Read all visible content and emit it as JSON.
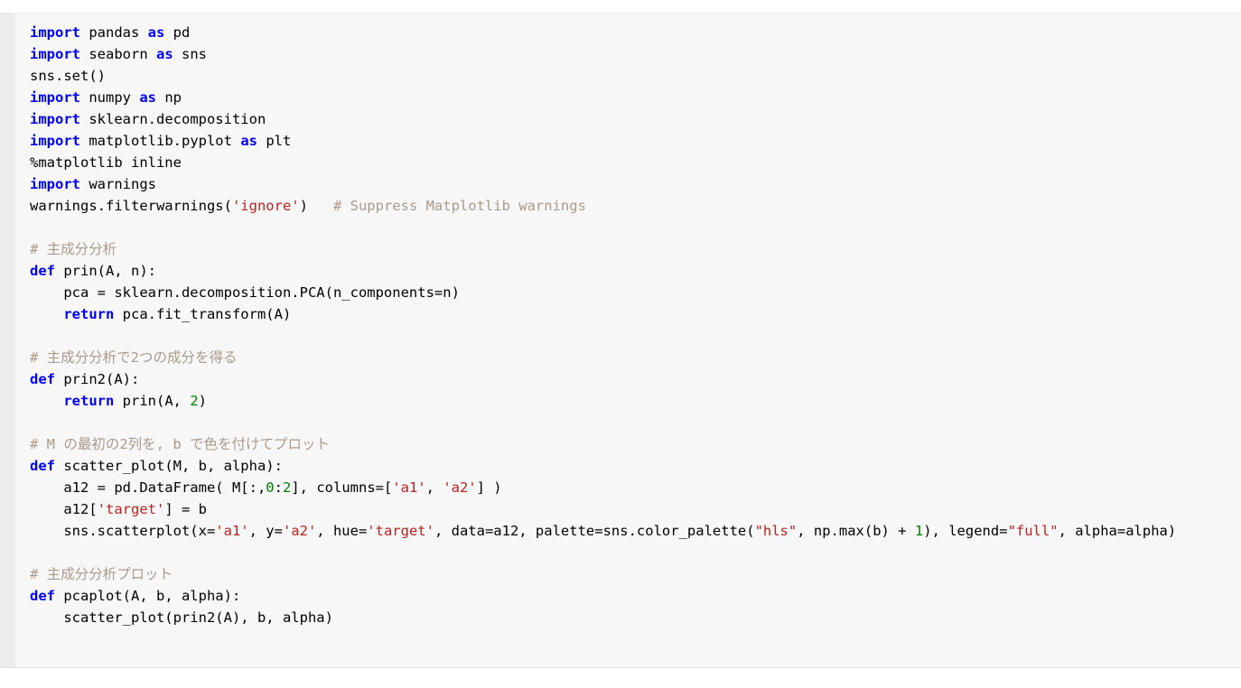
{
  "app": {
    "kind": "jupyter-notebook-code-cell",
    "background_color": "#ffffff",
    "cell_background_color": "#f7f7f7",
    "gutter_color": "#ececec"
  },
  "theme": {
    "keyword_color": "#0000ff",
    "string_color": "#ba2121",
    "comment_color": "#ab9a8a",
    "number_color": "#008000",
    "text_color": "#000000"
  },
  "cell": {
    "language": "python",
    "prompt": "",
    "lines": [
      {
        "tokens": [
          {
            "t": "import",
            "c": "k"
          },
          {
            "t": " pandas ",
            "c": "o"
          },
          {
            "t": "as",
            "c": "k"
          },
          {
            "t": " pd",
            "c": "o"
          }
        ]
      },
      {
        "tokens": [
          {
            "t": "import",
            "c": "k"
          },
          {
            "t": " seaborn ",
            "c": "o"
          },
          {
            "t": "as",
            "c": "k"
          },
          {
            "t": " sns",
            "c": "o"
          }
        ]
      },
      {
        "tokens": [
          {
            "t": "sns.set()",
            "c": "o"
          }
        ]
      },
      {
        "tokens": [
          {
            "t": "import",
            "c": "k"
          },
          {
            "t": " numpy ",
            "c": "o"
          },
          {
            "t": "as",
            "c": "k"
          },
          {
            "t": " np",
            "c": "o"
          }
        ]
      },
      {
        "tokens": [
          {
            "t": "import",
            "c": "k"
          },
          {
            "t": " sklearn.decomposition",
            "c": "o"
          }
        ]
      },
      {
        "tokens": [
          {
            "t": "import",
            "c": "k"
          },
          {
            "t": " matplotlib.pyplot ",
            "c": "o"
          },
          {
            "t": "as",
            "c": "k"
          },
          {
            "t": " plt",
            "c": "o"
          }
        ]
      },
      {
        "tokens": [
          {
            "t": "%matplotlib inline",
            "c": "o"
          }
        ]
      },
      {
        "tokens": [
          {
            "t": "import",
            "c": "k"
          },
          {
            "t": " warnings",
            "c": "o"
          }
        ]
      },
      {
        "tokens": [
          {
            "t": "warnings.filterwarnings(",
            "c": "o"
          },
          {
            "t": "'ignore'",
            "c": "s"
          },
          {
            "t": ")   ",
            "c": "o"
          },
          {
            "t": "# Suppress Matplotlib warnings",
            "c": "c"
          }
        ]
      },
      {
        "tokens": []
      },
      {
        "tokens": [
          {
            "t": "# 主成分分析",
            "c": "c"
          }
        ]
      },
      {
        "tokens": [
          {
            "t": "def",
            "c": "k"
          },
          {
            "t": " prin(A, n):",
            "c": "o"
          }
        ]
      },
      {
        "tokens": [
          {
            "t": "    pca = sklearn.decomposition.PCA(n_components=n)",
            "c": "o"
          }
        ]
      },
      {
        "tokens": [
          {
            "t": "    ",
            "c": "o"
          },
          {
            "t": "return",
            "c": "k"
          },
          {
            "t": " pca.fit_transform(A)",
            "c": "o"
          }
        ]
      },
      {
        "tokens": []
      },
      {
        "tokens": [
          {
            "t": "# 主成分分析で2つの成分を得る",
            "c": "c"
          }
        ]
      },
      {
        "tokens": [
          {
            "t": "def",
            "c": "k"
          },
          {
            "t": " prin2(A):",
            "c": "o"
          }
        ]
      },
      {
        "tokens": [
          {
            "t": "    ",
            "c": "o"
          },
          {
            "t": "return",
            "c": "k"
          },
          {
            "t": " prin(A, ",
            "c": "o"
          },
          {
            "t": "2",
            "c": "m"
          },
          {
            "t": ")",
            "c": "o"
          }
        ]
      },
      {
        "tokens": []
      },
      {
        "tokens": [
          {
            "t": "# M の最初の2列を, b で色を付けてプロット",
            "c": "c"
          }
        ]
      },
      {
        "tokens": [
          {
            "t": "def",
            "c": "k"
          },
          {
            "t": " scatter_plot(M, b, alpha):",
            "c": "o"
          }
        ]
      },
      {
        "tokens": [
          {
            "t": "    a12 = pd.DataFrame( M[:,",
            "c": "o"
          },
          {
            "t": "0",
            "c": "m"
          },
          {
            "t": ":",
            "c": "o"
          },
          {
            "t": "2",
            "c": "m"
          },
          {
            "t": "], columns=[",
            "c": "o"
          },
          {
            "t": "'a1'",
            "c": "s"
          },
          {
            "t": ", ",
            "c": "o"
          },
          {
            "t": "'a2'",
            "c": "s"
          },
          {
            "t": "] )",
            "c": "o"
          }
        ]
      },
      {
        "tokens": [
          {
            "t": "    a12[",
            "c": "o"
          },
          {
            "t": "'target'",
            "c": "s"
          },
          {
            "t": "] = b",
            "c": "o"
          }
        ]
      },
      {
        "tokens": [
          {
            "t": "    sns.scatterplot(x=",
            "c": "o"
          },
          {
            "t": "'a1'",
            "c": "s"
          },
          {
            "t": ", y=",
            "c": "o"
          },
          {
            "t": "'a2'",
            "c": "s"
          },
          {
            "t": ", hue=",
            "c": "o"
          },
          {
            "t": "'target'",
            "c": "s"
          },
          {
            "t": ", data=a12, palette=sns.color_palette(",
            "c": "o"
          },
          {
            "t": "\"hls\"",
            "c": "s"
          },
          {
            "t": ", np.max(b) + ",
            "c": "o"
          },
          {
            "t": "1",
            "c": "m"
          },
          {
            "t": "), legend=",
            "c": "o"
          },
          {
            "t": "\"full\"",
            "c": "s"
          },
          {
            "t": ", alpha=alpha)",
            "c": "o"
          }
        ]
      },
      {
        "tokens": []
      },
      {
        "tokens": [
          {
            "t": "# 主成分分析プロット",
            "c": "c"
          }
        ]
      },
      {
        "tokens": [
          {
            "t": "def",
            "c": "k"
          },
          {
            "t": " pcaplot(A, b, alpha):",
            "c": "o"
          }
        ]
      },
      {
        "tokens": [
          {
            "t": "    scatter_plot(prin2(A), b, alpha)",
            "c": "o"
          }
        ]
      }
    ]
  }
}
